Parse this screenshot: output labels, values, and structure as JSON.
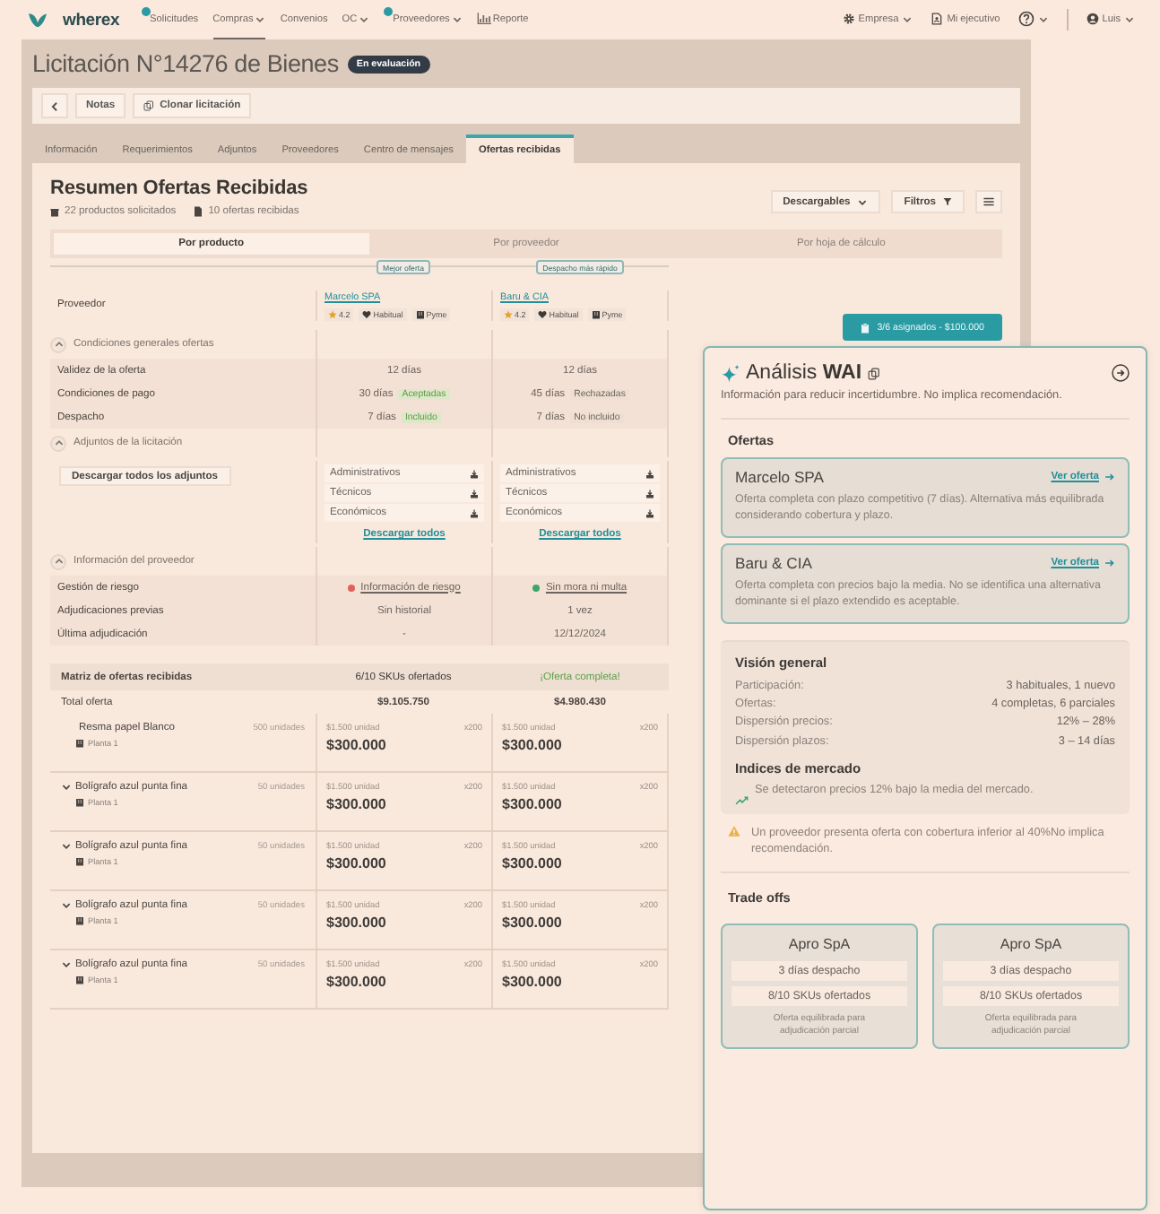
{
  "nav": {
    "logo": "wherex",
    "items": [
      {
        "label": "Solicitudes",
        "selected": false,
        "dropdown": false,
        "notify": true,
        "kind": "plain"
      },
      {
        "label": "Compras",
        "selected": true,
        "dropdown": true,
        "notify": false,
        "kind": "plain"
      },
      {
        "label": "Convenios",
        "selected": false,
        "dropdown": false,
        "notify": false,
        "kind": "plain"
      },
      {
        "label": "OC",
        "selected": false,
        "dropdown": true,
        "notify": false,
        "kind": "plain"
      },
      {
        "label": "Proveedores",
        "selected": false,
        "dropdown": true,
        "notify": true,
        "kind": "plain"
      },
      {
        "label": "Reporte",
        "selected": false,
        "dropdown": false,
        "notify": false,
        "kind": "chart"
      }
    ],
    "account": [
      {
        "kind": "company",
        "label": "Empresa",
        "dropdown": true
      },
      {
        "kind": "executive",
        "label": "Mi ejecutivo",
        "dropdown": false
      },
      {
        "kind": "help",
        "dropdown": true
      },
      {
        "kind": "user",
        "label": "Luis",
        "dropdown": true
      }
    ]
  },
  "header": {
    "title": "Licitación N°14276 de Bienes",
    "status": "En evaluación"
  },
  "toolbar": [
    {
      "kind": "back"
    },
    {
      "kind": "text",
      "label": "Notas"
    },
    {
      "kind": "copy",
      "label": "Clonar licitación"
    }
  ],
  "tabs": [
    {
      "label": "Información",
      "selected": false
    },
    {
      "label": "Requerimientos",
      "selected": false
    },
    {
      "label": "Adjuntos",
      "selected": false
    },
    {
      "label": "Proveedores",
      "selected": false
    },
    {
      "label": "Centro de mensajes",
      "selected": false
    },
    {
      "label": "Ofertas recibidas",
      "selected": true
    }
  ],
  "summary": {
    "title": "Resumen Ofertas Recibidas",
    "stats": [
      {
        "kind": "box",
        "text": "22 productos solicitados"
      },
      {
        "kind": "doc",
        "text": "10 ofertas recibidas"
      }
    ],
    "actions": [
      {
        "kind": "dropdown",
        "label": "Descargables"
      },
      {
        "kind": "filter",
        "label": "Filtros"
      },
      {
        "kind": "menu"
      }
    ]
  },
  "views": [
    {
      "label": "Por producto",
      "selected": true
    },
    {
      "label": "Por proveedor",
      "selected": false
    },
    {
      "label": "Por hoja de cálculo",
      "selected": false
    }
  ],
  "assign_button": "3/6 asignados - $100.000",
  "comparison": {
    "provider_label": "Proveedor",
    "suppliers": [
      {
        "highlight": "Mejor oferta",
        "name": "Marcelo SPA",
        "rating": "4.2",
        "tags": [
          {
            "kind": "heart",
            "text": "Habitual"
          },
          {
            "kind": "building",
            "text": "Pyme"
          }
        ]
      },
      {
        "highlight": "Despacho más rápido",
        "name": "Baru & CIA",
        "rating": "4.2",
        "tags": [
          {
            "kind": "heart",
            "text": "Habitual"
          },
          {
            "kind": "building",
            "text": "Pyme"
          }
        ]
      }
    ],
    "sections": [
      {
        "title": "Condiciones generales ofertas",
        "expanded": true,
        "kind": "rows",
        "rows": [
          {
            "label": "Validez de la oferta",
            "cells": [
              {
                "text": "12 días"
              },
              {
                "text": "12 días"
              }
            ]
          },
          {
            "label": "Condiciones de pago",
            "cells": [
              {
                "text": "30 días",
                "tag": "Aceptadas",
                "positive": true
              },
              {
                "text": "45 días",
                "tag": "Rechazadas",
                "positive": false
              }
            ]
          },
          {
            "label": "Despacho",
            "cells": [
              {
                "text": "7 días",
                "tag": "Incluido",
                "positive": true
              },
              {
                "text": "7 días",
                "tag": "No incluido",
                "positive": false
              }
            ]
          }
        ]
      },
      {
        "title": "Adjuntos de la licitación",
        "expanded": true,
        "kind": "files",
        "button": "Descargar todos los adjuntos",
        "cells": [
          {
            "files": [
              "Administrativos",
              "Técnicos",
              "Económicos"
            ],
            "link": "Descargar todos"
          },
          {
            "files": [
              "Administrativos",
              "Técnicos",
              "Económicos"
            ],
            "link": "Descargar todos"
          }
        ]
      },
      {
        "title": "Información del proveedor",
        "expanded": true,
        "kind": "rows",
        "rows": [
          {
            "label": "Gestión de riesgo",
            "cells": [
              {
                "text": "Información de riesgo",
                "color": "#e2605a"
              },
              {
                "text": "Sin mora ni multa",
                "color": "#3da56a"
              }
            ]
          },
          {
            "label": "Adjudicaciones previas",
            "cells": [
              {
                "text": "Sin historial"
              },
              {
                "text": "1 vez"
              }
            ]
          },
          {
            "label": "Última adjudicación",
            "cells": [
              {
                "text": "-"
              },
              {
                "text": "12/12/2024"
              }
            ]
          }
        ]
      }
    ]
  },
  "matrix": {
    "title": "Matriz de ofertas recibidas",
    "summary": [
      {
        "text": "6/10 SKUs ofertados",
        "positive": false
      },
      {
        "text": "¡Oferta completa!",
        "positive": true
      }
    ],
    "total_label": "Total oferta",
    "totals": [
      "$9.105.750",
      "$4.980.430"
    ],
    "products": [
      {
        "name": "Resma papel Blanco",
        "location": "Planta 1",
        "quantity": "500 unidades",
        "expandable": false,
        "offers": [
          {
            "unit_price": "$1.500 unidad",
            "multiplier": "x200",
            "total": "$300.000"
          },
          {
            "unit_price": "$1.500 unidad",
            "multiplier": "x200",
            "total": "$300.000"
          }
        ]
      },
      {
        "name": "Bolígrafo azul punta fina",
        "location": "Planta 1",
        "quantity": "50 unidades",
        "expandable": true,
        "offers": [
          {
            "unit_price": "$1.500 unidad",
            "multiplier": "x200",
            "total": "$300.000"
          },
          {
            "unit_price": "$1.500 unidad",
            "multiplier": "x200",
            "total": "$300.000"
          }
        ]
      },
      {
        "name": "Bolígrafo azul punta fina",
        "location": "Planta 1",
        "quantity": "50 unidades",
        "expandable": true,
        "offers": [
          {
            "unit_price": "$1.500 unidad",
            "multiplier": "x200",
            "total": "$300.000"
          },
          {
            "unit_price": "$1.500 unidad",
            "multiplier": "x200",
            "total": "$300.000"
          }
        ]
      },
      {
        "name": "Bolígrafo azul punta fina",
        "location": "Planta 1",
        "quantity": "50 unidades",
        "expandable": true,
        "offers": [
          {
            "unit_price": "$1.500 unidad",
            "multiplier": "x200",
            "total": "$300.000"
          },
          {
            "unit_price": "$1.500 unidad",
            "multiplier": "x200",
            "total": "$300.000"
          }
        ]
      },
      {
        "name": "Bolígrafo azul punta fina",
        "location": "Planta 1",
        "quantity": "50 unidades",
        "expandable": true,
        "offers": [
          {
            "unit_price": "$1.500 unidad",
            "multiplier": "x200",
            "total": "$300.000"
          },
          {
            "unit_price": "$1.500 unidad",
            "multiplier": "x200",
            "total": "$300.000"
          }
        ]
      }
    ]
  },
  "analysis": {
    "title": "Análisis **WAI**",
    "subtitle": "Información para reducir incertidumbre. No implica recomendación.",
    "offers_title": "Ofertas",
    "offers": [
      {
        "name": "Marcelo SPA",
        "link": "Ver oferta",
        "text": "Oferta completa con plazo competitivo (7 días). Alternativa más equilibrada considerando cobertura y plazo."
      },
      {
        "name": "Baru & CIA",
        "link": "Ver oferta",
        "text": "Oferta completa con precios bajo la media. No se identifica una alternativa dominante si el plazo extendido es aceptable."
      }
    ],
    "overview": {
      "title": "Visión general",
      "rows": [
        {
          "label": "Participación:",
          "value": "3 habituales, 1 nuevo"
        },
        {
          "label": "Ofertas:",
          "value": "4 completas, 6 parciales"
        },
        {
          "label": "Dispersión precios:",
          "value": "12% – 28%"
        },
        {
          "label": "Dispersión plazos:",
          "value": "3 – 14 días"
        }
      ],
      "market_title": "Indices de mercado",
      "market_text": "Se detectaron precios 12% bajo la media del mercado."
    },
    "warning": "Un proveedor presenta oferta con cobertura inferior al 40%No implica recomendación.",
    "tradeoffs_title": "Trade offs",
    "tradeoffs": [
      {
        "name": "Apro SpA",
        "facts": [
          "3 días despacho",
          "8/10 SKUs ofertados"
        ],
        "note": "Oferta equilibrada para adjudicación parcial"
      },
      {
        "name": "Apro SpA",
        "facts": [
          "3 días despacho",
          "8/10 SKUs ofertados"
        ],
        "note": "Oferta equilibrada para adjudicación parcial"
      }
    ]
  }
}
